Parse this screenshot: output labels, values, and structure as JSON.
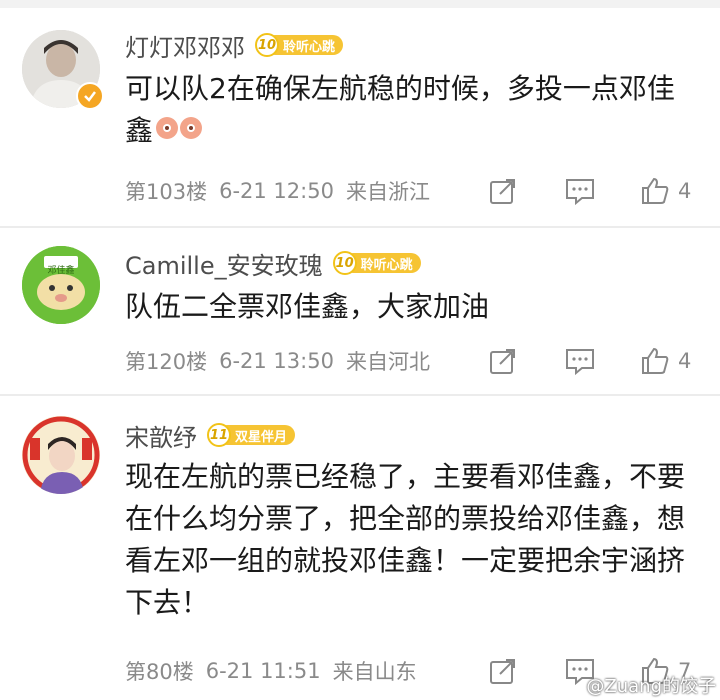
{
  "comments": [
    {
      "username": "灯灯邓邓邓",
      "badge_level": "10",
      "badge_label": "聆听心跳",
      "text": "可以队2在确保左航稳的时候，多投一点邓佳鑫",
      "floor": "第103楼",
      "time": "6-21 12:50",
      "location": "来自浙江",
      "like_count": "4"
    },
    {
      "username": "Camille_安安玫瑰",
      "badge_level": "10",
      "badge_label": "聆听心跳",
      "text": "队伍二全票邓佳鑫，大家加油",
      "floor": "第120楼",
      "time": "6-21 13:50",
      "location": "来自河北",
      "like_count": "4",
      "avatar_text": "邓佳鑫"
    },
    {
      "username": "宋歆纾",
      "badge_level": "11",
      "badge_label": "双星伴月",
      "text": "现在左航的票已经稳了，主要看邓佳鑫，不要在什么均分票了，把全部的票投给邓佳鑫，想看左邓一组的就投邓佳鑫！一定要把余宇涵挤下去！",
      "floor": "第80楼",
      "time": "6-21 11:51",
      "location": "来自山东",
      "like_count": "7"
    }
  ],
  "watermark": "@Zuang的饺子",
  "icons": [
    "repost-icon",
    "comment-icon",
    "like-icon",
    "verified-icon",
    "emoji-icon"
  ],
  "colors": {
    "badge": "#f6c433",
    "text": "#1a1a1a",
    "meta": "#8a8a8a",
    "verified": "#f5a623"
  }
}
